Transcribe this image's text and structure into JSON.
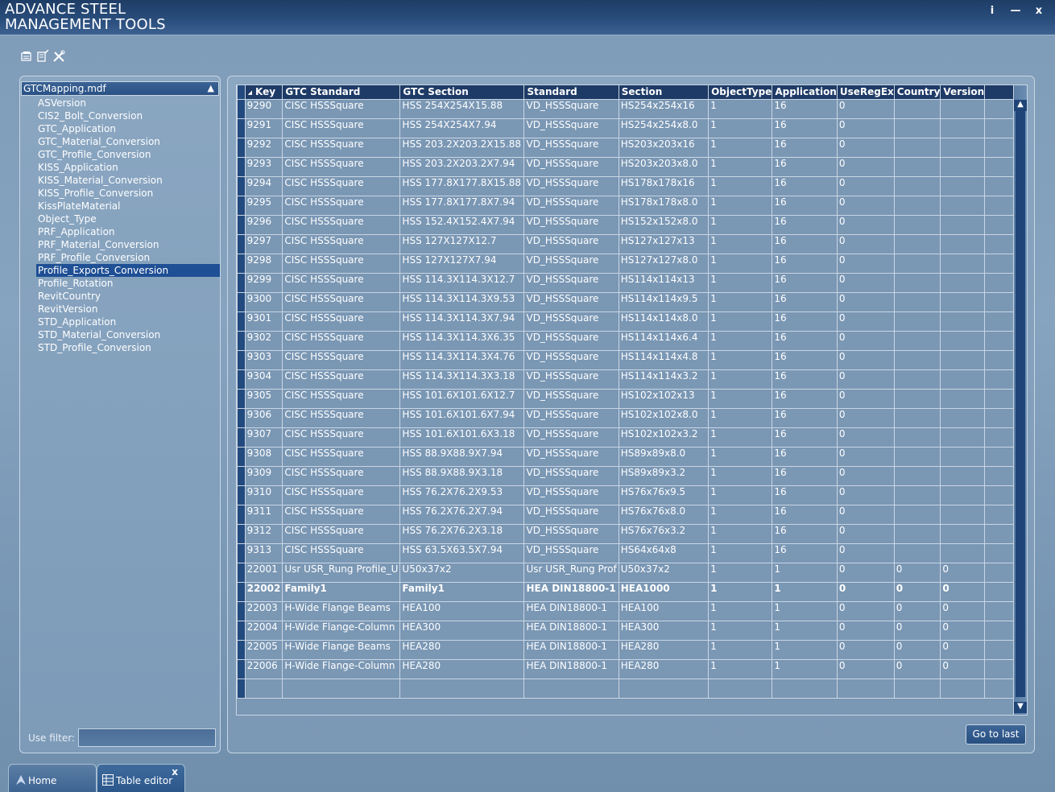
{
  "window": {
    "title": "ADVANCE STEEL\nMANAGEMENT TOOLS",
    "btn_info": "i",
    "btn_minimize": "—",
    "btn_close": "x"
  },
  "toolbar": {
    "icons": [
      "database-icon",
      "edit-table-icon",
      "tools-icon"
    ]
  },
  "left_panel": {
    "database": "GTCMapping.mdf",
    "tables": [
      "ASVersion",
      "CIS2_Bolt_Conversion",
      "GTC_Application",
      "GTC_Material_Conversion",
      "GTC_Profile_Conversion",
      "KISS_Application",
      "KISS_Material_Conversion",
      "KISS_Profile_Conversion",
      "KissPlateMaterial",
      "Object_Type",
      "PRF_Application",
      "PRF_Material_Conversion",
      "PRF_Profile_Conversion",
      "Profile_Exports_Conversion",
      "Profile_Rotation",
      "RevitCountry",
      "RevitVersion",
      "STD_Application",
      "STD_Material_Conversion",
      "STD_Profile_Conversion"
    ],
    "selected_index": 13,
    "filter_label": "Use filter:",
    "filter_value": ""
  },
  "grid": {
    "columns": [
      "Key",
      "GTC Standard",
      "GTC Section",
      "Standard",
      "Section",
      "ObjectType",
      "Application",
      "UseRegEx",
      "Country",
      "Version"
    ],
    "rows": [
      [
        "9290",
        "CISC HSSSquare",
        "HSS 254X254X15.88",
        "VD_HSSSquare",
        "HS254x254x16",
        "1",
        "16",
        "0",
        "",
        ""
      ],
      [
        "9291",
        "CISC HSSSquare",
        "HSS 254X254X7.94",
        "VD_HSSSquare",
        "HS254x254x8.0",
        "1",
        "16",
        "0",
        "",
        ""
      ],
      [
        "9292",
        "CISC HSSSquare",
        "HSS 203.2X203.2X15.88",
        "VD_HSSSquare",
        "HS203x203x16",
        "1",
        "16",
        "0",
        "",
        ""
      ],
      [
        "9293",
        "CISC HSSSquare",
        "HSS 203.2X203.2X7.94",
        "VD_HSSSquare",
        "HS203x203x8.0",
        "1",
        "16",
        "0",
        "",
        ""
      ],
      [
        "9294",
        "CISC HSSSquare",
        "HSS 177.8X177.8X15.88",
        "VD_HSSSquare",
        "HS178x178x16",
        "1",
        "16",
        "0",
        "",
        ""
      ],
      [
        "9295",
        "CISC HSSSquare",
        "HSS 177.8X177.8X7.94",
        "VD_HSSSquare",
        "HS178x178x8.0",
        "1",
        "16",
        "0",
        "",
        ""
      ],
      [
        "9296",
        "CISC HSSSquare",
        "HSS 152.4X152.4X7.94",
        "VD_HSSSquare",
        "HS152x152x8.0",
        "1",
        "16",
        "0",
        "",
        ""
      ],
      [
        "9297",
        "CISC HSSSquare",
        "HSS 127X127X12.7",
        "VD_HSSSquare",
        "HS127x127x13",
        "1",
        "16",
        "0",
        "",
        ""
      ],
      [
        "9298",
        "CISC HSSSquare",
        "HSS 127X127X7.94",
        "VD_HSSSquare",
        "HS127x127x8.0",
        "1",
        "16",
        "0",
        "",
        ""
      ],
      [
        "9299",
        "CISC HSSSquare",
        "HSS 114.3X114.3X12.7",
        "VD_HSSSquare",
        "HS114x114x13",
        "1",
        "16",
        "0",
        "",
        ""
      ],
      [
        "9300",
        "CISC HSSSquare",
        "HSS 114.3X114.3X9.53",
        "VD_HSSSquare",
        "HS114x114x9.5",
        "1",
        "16",
        "0",
        "",
        ""
      ],
      [
        "9301",
        "CISC HSSSquare",
        "HSS 114.3X114.3X7.94",
        "VD_HSSSquare",
        "HS114x114x8.0",
        "1",
        "16",
        "0",
        "",
        ""
      ],
      [
        "9302",
        "CISC HSSSquare",
        "HSS 114.3X114.3X6.35",
        "VD_HSSSquare",
        "HS114x114x6.4",
        "1",
        "16",
        "0",
        "",
        ""
      ],
      [
        "9303",
        "CISC HSSSquare",
        "HSS 114.3X114.3X4.76",
        "VD_HSSSquare",
        "HS114x114x4.8",
        "1",
        "16",
        "0",
        "",
        ""
      ],
      [
        "9304",
        "CISC HSSSquare",
        "HSS 114.3X114.3X3.18",
        "VD_HSSSquare",
        "HS114x114x3.2",
        "1",
        "16",
        "0",
        "",
        ""
      ],
      [
        "9305",
        "CISC HSSSquare",
        "HSS 101.6X101.6X12.7",
        "VD_HSSSquare",
        "HS102x102x13",
        "1",
        "16",
        "0",
        "",
        ""
      ],
      [
        "9306",
        "CISC HSSSquare",
        "HSS 101.6X101.6X7.94",
        "VD_HSSSquare",
        "HS102x102x8.0",
        "1",
        "16",
        "0",
        "",
        ""
      ],
      [
        "9307",
        "CISC HSSSquare",
        "HSS 101.6X101.6X3.18",
        "VD_HSSSquare",
        "HS102x102x3.2",
        "1",
        "16",
        "0",
        "",
        ""
      ],
      [
        "9308",
        "CISC HSSSquare",
        "HSS 88.9X88.9X7.94",
        "VD_HSSSquare",
        "HS89x89x8.0",
        "1",
        "16",
        "0",
        "",
        ""
      ],
      [
        "9309",
        "CISC HSSSquare",
        "HSS 88.9X88.9X3.18",
        "VD_HSSSquare",
        "HS89x89x3.2",
        "1",
        "16",
        "0",
        "",
        ""
      ],
      [
        "9310",
        "CISC HSSSquare",
        "HSS 76.2X76.2X9.53",
        "VD_HSSSquare",
        "HS76x76x9.5",
        "1",
        "16",
        "0",
        "",
        ""
      ],
      [
        "9311",
        "CISC HSSSquare",
        "HSS 76.2X76.2X7.94",
        "VD_HSSSquare",
        "HS76x76x8.0",
        "1",
        "16",
        "0",
        "",
        ""
      ],
      [
        "9312",
        "CISC HSSSquare",
        "HSS 76.2X76.2X3.18",
        "VD_HSSSquare",
        "HS76x76x3.2",
        "1",
        "16",
        "0",
        "",
        ""
      ],
      [
        "9313",
        "CISC HSSSquare",
        "HSS 63.5X63.5X7.94",
        "VD_HSSSquare",
        "HS64x64x8",
        "1",
        "16",
        "0",
        "",
        ""
      ],
      [
        "22001",
        "Usr USR_Rung Profile_U",
        "U50x37x2",
        "Usr USR_Rung Prof",
        "U50x37x2",
        "1",
        "1",
        "0",
        "0",
        "0"
      ],
      [
        "22002",
        "Family1",
        "Family1",
        "HEA  DIN18800-1",
        "HEA1000",
        "1",
        "1",
        "0",
        "0",
        "0"
      ],
      [
        "22003",
        "H-Wide Flange Beams",
        "HEA100",
        "HEA  DIN18800-1",
        "HEA100",
        "1",
        "1",
        "0",
        "0",
        "0"
      ],
      [
        "22004",
        "H-Wide Flange-Column",
        "HEA300",
        "HEA  DIN18800-1",
        "HEA300",
        "1",
        "1",
        "0",
        "0",
        "0"
      ],
      [
        "22005",
        "H-Wide Flange Beams",
        "HEA280",
        "HEA  DIN18800-1",
        "HEA280",
        "1",
        "1",
        "0",
        "0",
        "0"
      ],
      [
        "22006",
        "H-Wide Flange-Column",
        "HEA280",
        "HEA  DIN18800-1",
        "HEA280",
        "1",
        "1",
        "0",
        "0",
        "0"
      ]
    ],
    "bold_row_index": 25,
    "goto_last_label": "Go to last"
  },
  "tabs": {
    "home": "Home",
    "editor": "Table editor",
    "close": "x"
  },
  "colors": {
    "titlebar": "#1e3d66",
    "selection": "#1f4f94",
    "header": "#1e3a66"
  }
}
